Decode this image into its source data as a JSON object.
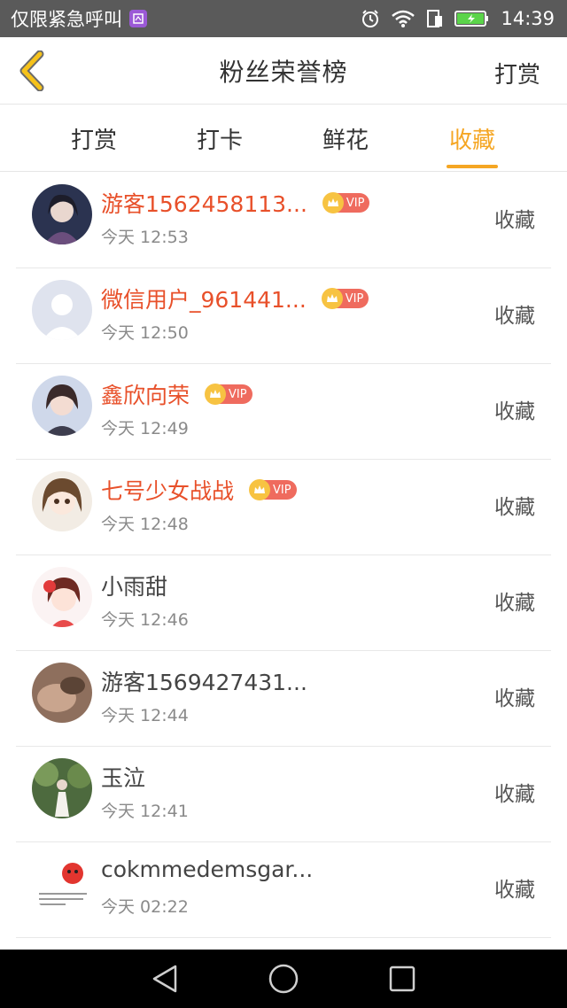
{
  "status_bar": {
    "carrier": "仅限紧急呼叫",
    "time": "14:39"
  },
  "header": {
    "title": "粉丝荣誉榜",
    "action": "打赏"
  },
  "tabs": [
    {
      "label": "打赏",
      "active": false
    },
    {
      "label": "打卡",
      "active": false
    },
    {
      "label": "鲜花",
      "active": false
    },
    {
      "label": "收藏",
      "active": true
    }
  ],
  "vip_label": "VIP",
  "rows": [
    {
      "name": "游客1562458113...",
      "time": "今天 12:53",
      "action": "收藏",
      "vip": true
    },
    {
      "name": "微信用户_961441...",
      "time": "今天 12:50",
      "action": "收藏",
      "vip": true
    },
    {
      "name": "鑫欣向荣",
      "time": "今天 12:49",
      "action": "收藏",
      "vip": true
    },
    {
      "name": "七号少女战战",
      "time": "今天 12:48",
      "action": "收藏",
      "vip": true
    },
    {
      "name": "小雨甜",
      "time": "今天 12:46",
      "action": "收藏",
      "vip": false
    },
    {
      "name": "游客1569427431...",
      "time": "今天 12:44",
      "action": "收藏",
      "vip": false
    },
    {
      "name": "玉泣",
      "time": "今天 12:41",
      "action": "收藏",
      "vip": false
    },
    {
      "name": "cokmmedemsgar...",
      "time": "今天 02:22",
      "action": "收藏",
      "vip": false
    }
  ],
  "colors": {
    "accent": "#f5a623",
    "vip_name": "#e8502a",
    "vip_badge": "#ef6b5e"
  }
}
